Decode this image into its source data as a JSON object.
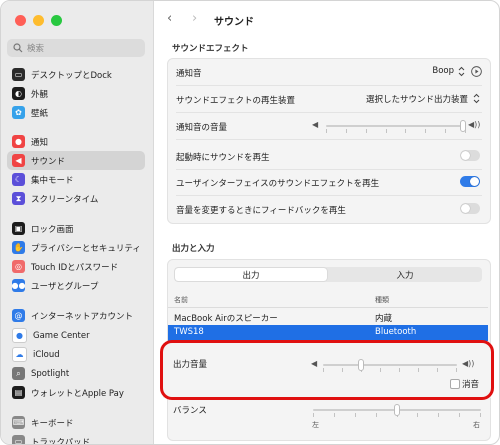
{
  "window": {
    "title": "サウンド",
    "traffic_lights": [
      "#ff5f57",
      "#febc2e",
      "#28c840"
    ]
  },
  "sidebar": {
    "search_placeholder": "検索",
    "items": [
      {
        "label": "デスクトップとDock",
        "icon": "dock-icon",
        "color": "#2b2b2b"
      },
      {
        "label": "外観",
        "icon": "appearance-icon",
        "color": "#1c1c1c"
      },
      {
        "label": "壁紙",
        "icon": "wallpaper-icon",
        "color": "#36a2ea"
      },
      {
        "label": "通知",
        "icon": "bell-icon",
        "color": "#f04444"
      },
      {
        "label": "サウンド",
        "icon": "speaker-icon",
        "color": "#f04444"
      },
      {
        "label": "集中モード",
        "icon": "moon-icon",
        "color": "#5b4fd9"
      },
      {
        "label": "スクリーンタイム",
        "icon": "hourglass-icon",
        "color": "#5b4fd9"
      },
      {
        "label": "ロック画面",
        "icon": "lock-screen-icon",
        "color": "#1c1c1c"
      },
      {
        "label": "プライバシーとセキュリティ",
        "icon": "hand-icon",
        "color": "#2f7be8"
      },
      {
        "label": "Touch IDとパスワード",
        "icon": "fingerprint-icon",
        "color": "#f06a6a"
      },
      {
        "label": "ユーザとグループ",
        "icon": "users-icon",
        "color": "#2f7be8"
      },
      {
        "label": "インターネットアカウント",
        "icon": "at-icon",
        "color": "#2f7be8"
      },
      {
        "label": "Game Center",
        "icon": "game-center-icon",
        "color": "#ffffff"
      },
      {
        "label": "iCloud",
        "icon": "cloud-icon",
        "color": "#ffffff"
      },
      {
        "label": "Spotlight",
        "icon": "spotlight-icon",
        "color": "#777777"
      },
      {
        "label": "ウォレットとApple Pay",
        "icon": "wallet-icon",
        "color": "#1c1c1c"
      },
      {
        "label": "キーボード",
        "icon": "keyboard-icon",
        "color": "#888888"
      },
      {
        "label": "トラックパッド",
        "icon": "trackpad-icon",
        "color": "#888888"
      }
    ],
    "selected_index": 4
  },
  "sound_effects": {
    "section_title": "サウンドエフェクト",
    "alert_sound_label": "通知音",
    "alert_sound_value": "Boop",
    "output_device_label": "サウンドエフェクトの再生装置",
    "output_device_value": "選択したサウンド出力装置",
    "alert_volume_label": "通知音の音量",
    "alert_volume": 1.0,
    "startup_label": "起動時にサウンドを再生",
    "startup_on": false,
    "ui_effects_label": "ユーザインターフェイスのサウンドエフェクトを再生",
    "ui_effects_on": true,
    "feedback_label": "音量を変更するときにフィードバックを再生",
    "feedback_on": false
  },
  "io": {
    "section_title": "出力と入力",
    "tabs": [
      "出力",
      "入力"
    ],
    "selected_tab": 0,
    "columns": [
      "名前",
      "種類"
    ],
    "devices": [
      {
        "name": "MacBook Airのスピーカー",
        "type": "内蔵",
        "selected": false
      },
      {
        "name": "TWS18",
        "type": "Bluetooth",
        "selected": true
      }
    ],
    "output_volume_label": "出力音量",
    "output_volume": 0.27,
    "mute_label": "消音",
    "mute_checked": false,
    "balance_label": "バランス",
    "balance": 0.5,
    "balance_left": "左",
    "balance_right": "右"
  },
  "colors": {
    "accent": "#2f7be8",
    "toggle_off": "#dcdcdc",
    "selection": "#1f6fe5",
    "highlight": "#e01010"
  }
}
